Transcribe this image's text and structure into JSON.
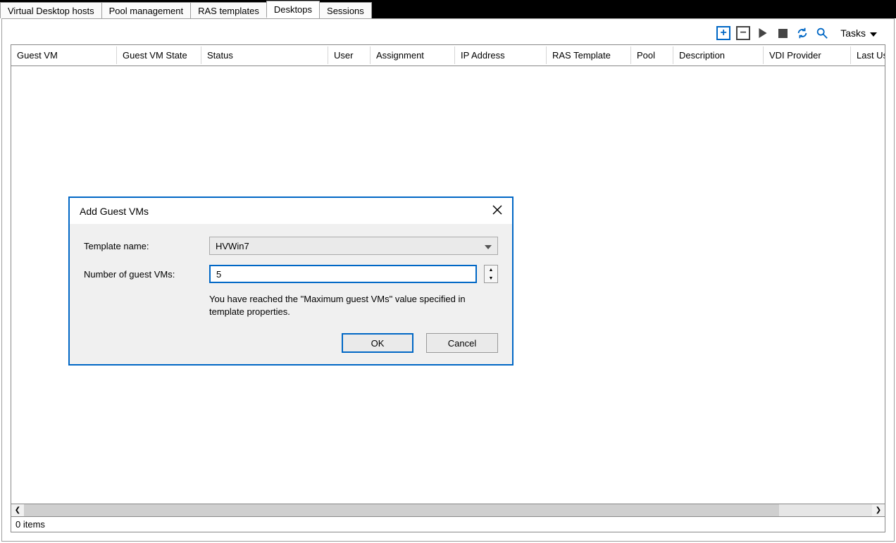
{
  "tabs": {
    "vdhosts": "Virtual Desktop hosts",
    "pool": "Pool management",
    "templates": "RAS templates",
    "desktops": "Desktops",
    "sessions": "Sessions"
  },
  "toolbar": {
    "tasks_label": "Tasks"
  },
  "columns": {
    "c0": "Guest VM",
    "c1": "Guest VM State",
    "c2": "Status",
    "c3": "User",
    "c4": "Assignment",
    "c5": "IP Address",
    "c6": "RAS Template",
    "c7": "Pool",
    "c8": "Description",
    "c9": "VDI Provider",
    "c10": "Last Us"
  },
  "status": {
    "items": "0 items"
  },
  "dialog": {
    "title": "Add Guest VMs",
    "template_label": "Template name:",
    "template_value": "HVWin7",
    "vms_label": "Number of guest VMs:",
    "vms_value": "5",
    "message": "You have reached the \"Maximum guest VMs\" value specified in template properties.",
    "ok": "OK",
    "cancel": "Cancel"
  }
}
